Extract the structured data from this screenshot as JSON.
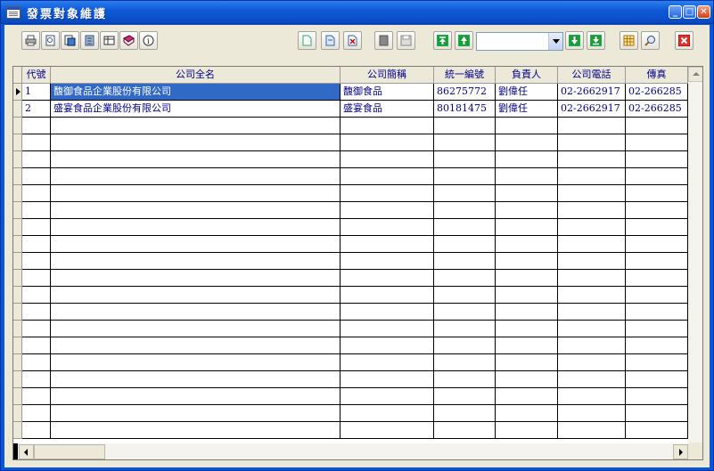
{
  "window": {
    "title": "發票對象維護",
    "controls": [
      "minimize",
      "maximize",
      "close"
    ]
  },
  "toolbar": {
    "left_group": [
      "print-icon",
      "print-preview-icon",
      "export-icon",
      "report-icon",
      "table-icon",
      "book-icon",
      "info-icon"
    ],
    "record_group": [
      "new-record-icon",
      "edit-record-icon",
      "delete-record-icon"
    ],
    "save_group": [
      "cancel-icon",
      "save-icon"
    ],
    "nav_up": [
      "first-record-icon",
      "prev-record-icon"
    ],
    "search_combo": {
      "value": ""
    },
    "nav_down": [
      "next-record-icon",
      "last-record-icon"
    ],
    "view_group": [
      "grid-view-icon",
      "find-icon"
    ],
    "exit": "exit-icon"
  },
  "grid": {
    "columns": [
      "代號",
      "公司全名",
      "公司簡稱",
      "統一編號",
      "負責人",
      "公司電話",
      "傳真"
    ],
    "rows": [
      [
        "1",
        "馥御食品企業股份有限公司",
        "馥御食品",
        "86275772",
        "劉偉任",
        "02-2662917",
        "02-266285"
      ],
      [
        "2",
        "盛宴食品企業股份有限公司",
        "盛宴食品",
        "80181475",
        "劉偉任",
        "02-2662917",
        "02-266285"
      ]
    ],
    "selected_row": 0
  },
  "colors": {
    "title_bar": "#0a56d8",
    "selection": "#3169c6",
    "cell_text": "#00008b",
    "chrome": "#ece9d8"
  }
}
